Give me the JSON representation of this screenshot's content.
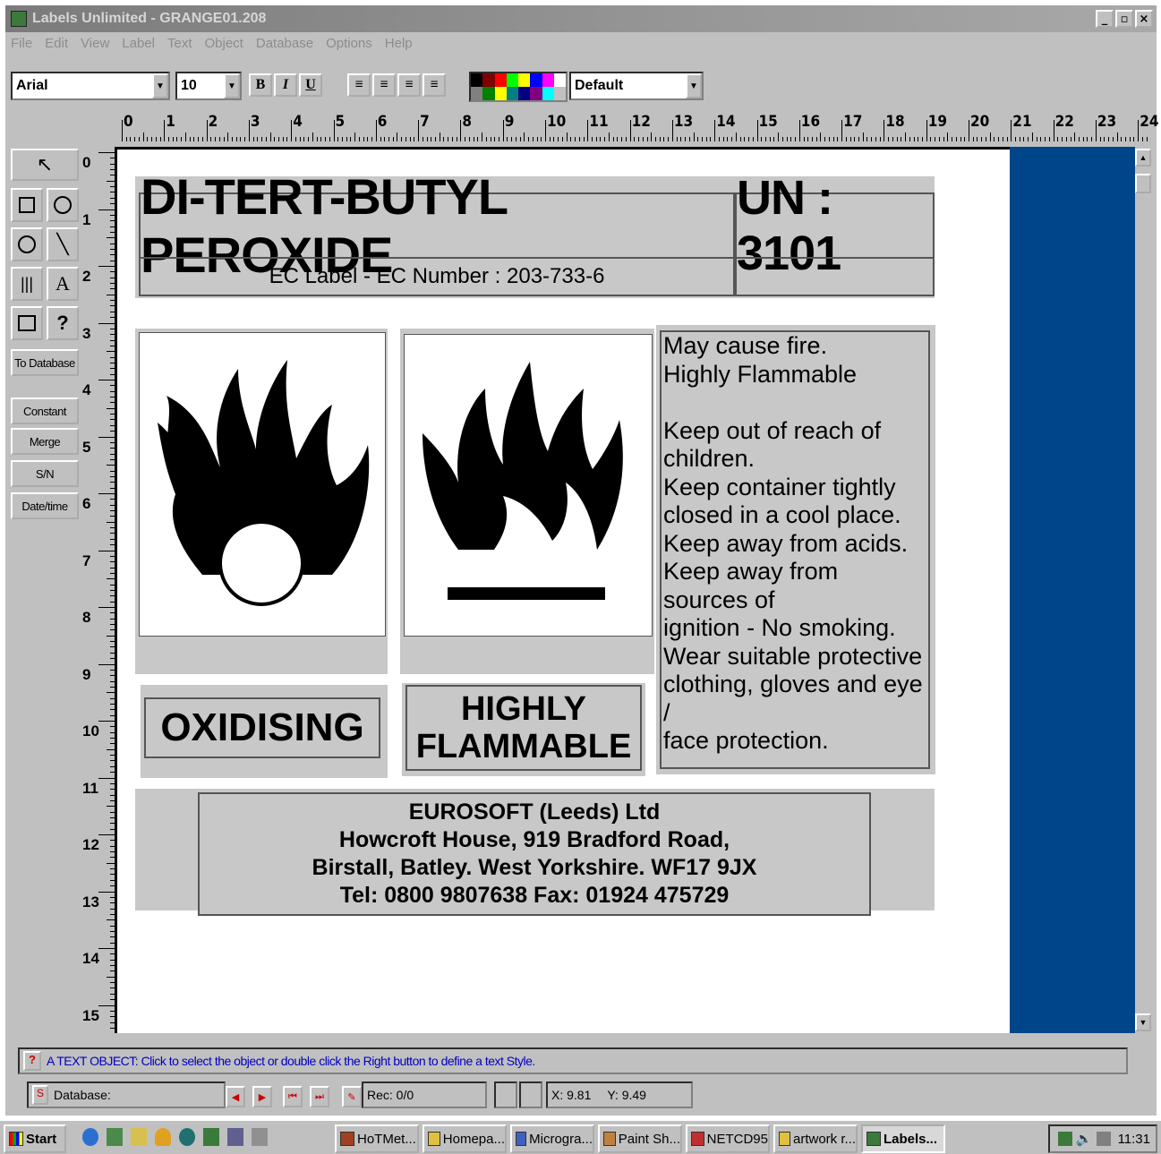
{
  "window": {
    "title": "Labels Unlimited  -  GRANGE01.208",
    "controls": [
      "_",
      "▫",
      "×"
    ]
  },
  "menu": [
    "File",
    "Edit",
    "View",
    "Label",
    "Text",
    "Object",
    "Database",
    "Options",
    "Help"
  ],
  "toolbar": {
    "font": "Arial",
    "size": "10",
    "bold": "B",
    "italic": "I",
    "underline": "U",
    "style": "Default",
    "palette": [
      "#000000",
      "#7f0000",
      "#ff0000",
      "#00ff00",
      "#ffff00",
      "#0000ff",
      "#ff00ff",
      "#ffffff",
      "#808080",
      "#008000",
      "#ffff00",
      "#008080",
      "#000080",
      "#800080",
      "#00ffff",
      "#c0c0c0"
    ]
  },
  "ruler": {
    "h_labels": [
      "0",
      "1",
      "2",
      "3",
      "4",
      "5",
      "6",
      "7",
      "8",
      "9",
      "10",
      "11",
      "12",
      "13",
      "14",
      "15",
      "16",
      "17",
      "18",
      "19",
      "20",
      "21",
      "22",
      "23",
      "24"
    ],
    "v_labels": [
      "0",
      "1",
      "2",
      "3",
      "4",
      "5",
      "6",
      "7",
      "8",
      "9",
      "10",
      "11",
      "12",
      "13",
      "14",
      "15"
    ]
  },
  "toolbox": {
    "select": "↖",
    "text_tool": "A",
    "help_tool": "?",
    "to_database": "To Database",
    "constant": "Constant",
    "merge": "Merge",
    "serial": "S/N",
    "datetime": "Date/time"
  },
  "label": {
    "product": "DI-TERT-BUTYL PEROXIDE",
    "un": "UN : 3101",
    "ec_line": "EC Label  -  EC Number : 203-733-6",
    "hazard1": "OXIDISING",
    "hazard2_line1": "HIGHLY",
    "hazard2_line2": "FLAMMABLE",
    "instructions": [
      "May cause fire.",
      "Highly  Flammable",
      "",
      "Keep out of reach of",
      "children.",
      "Keep container tightly",
      "closed in a cool place.",
      "Keep away from acids.",
      "Keep away from sources of",
      "ignition - No smoking.",
      "Wear suitable protective",
      "clothing, gloves and eye /",
      "face  protection."
    ],
    "address": [
      "EUROSOFT (Leeds) Ltd",
      "Howcroft House, 919 Bradford Road,",
      "Birstall, Batley. West Yorkshire. WF17 9JX",
      "Tel: 0800 9807638  Fax: 01924 475729"
    ]
  },
  "status": {
    "help_text": "A TEXT OBJECT: Click to select the object or double click the Right button to define a text Style.",
    "database": "Database:",
    "rec": "Rec: 0/0",
    "x": "X: 9.81",
    "y": "Y: 9.49"
  },
  "taskbar": {
    "start": "Start",
    "tasks": [
      "HoTMet...",
      "Homepa...",
      "Microgra...",
      "Paint Sh...",
      "NETCD95",
      "artwork r...",
      "Labels..."
    ],
    "time": "11:31"
  }
}
